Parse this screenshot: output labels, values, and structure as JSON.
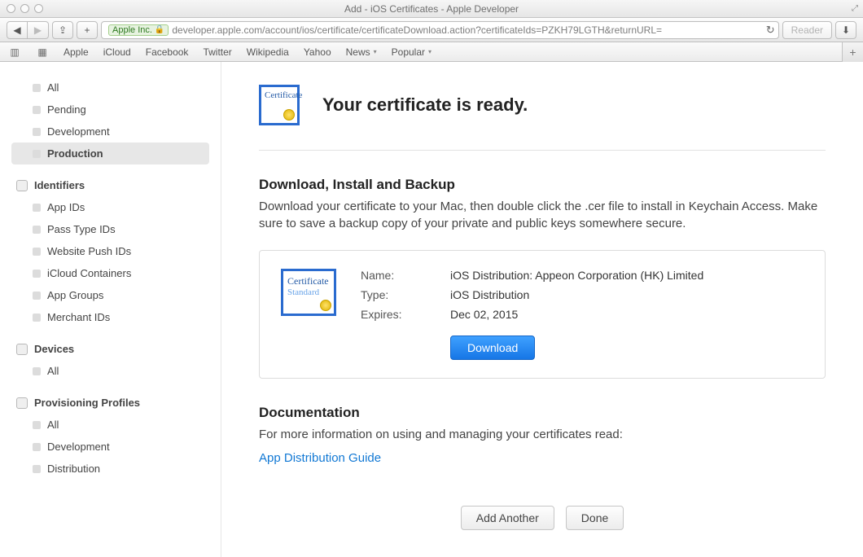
{
  "window": {
    "title": "Add - iOS Certificates - Apple Developer"
  },
  "url": {
    "company": "Apple Inc.",
    "address": "developer.apple.com/account/ios/certificate/certificateDownload.action?certificateIds=PZKH79LGTH&returnURL="
  },
  "reader_label": "Reader",
  "bookmarks": {
    "items": [
      "Apple",
      "iCloud",
      "Facebook",
      "Twitter",
      "Wikipedia",
      "Yahoo",
      "News",
      "Popular"
    ],
    "with_menu": [
      6,
      7
    ]
  },
  "sidebar": {
    "certs": {
      "items": [
        "All",
        "Pending",
        "Development",
        "Production"
      ],
      "active": 3
    },
    "identifiers": {
      "head": "Identifiers",
      "items": [
        "App IDs",
        "Pass Type IDs",
        "Website Push IDs",
        "iCloud Containers",
        "App Groups",
        "Merchant IDs"
      ]
    },
    "devices": {
      "head": "Devices",
      "items": [
        "All"
      ]
    },
    "profiles": {
      "head": "Provisioning Profiles",
      "items": [
        "All",
        "Development",
        "Distribution"
      ]
    }
  },
  "main": {
    "ready": "Your certificate is ready.",
    "dl_head": "Download, Install and Backup",
    "dl_body": "Download your certificate to your Mac, then double click the .cer file to install in Keychain Access. Make sure to save a backup copy of your private and public keys somewhere secure.",
    "cert": {
      "name_k": "Name:",
      "name_v": "iOS Distribution: Appeon Corporation (HK) Limited",
      "type_k": "Type:",
      "type_v": "iOS Distribution",
      "exp_k": "Expires:",
      "exp_v": "Dec 02, 2015",
      "download": "Download"
    },
    "doc_head": "Documentation",
    "doc_body": "For more information on using and managing your certificates read:",
    "doc_link": "App Distribution Guide",
    "add_another": "Add Another",
    "done": "Done",
    "cert_word": "Certificate",
    "std_word": "Standard"
  }
}
